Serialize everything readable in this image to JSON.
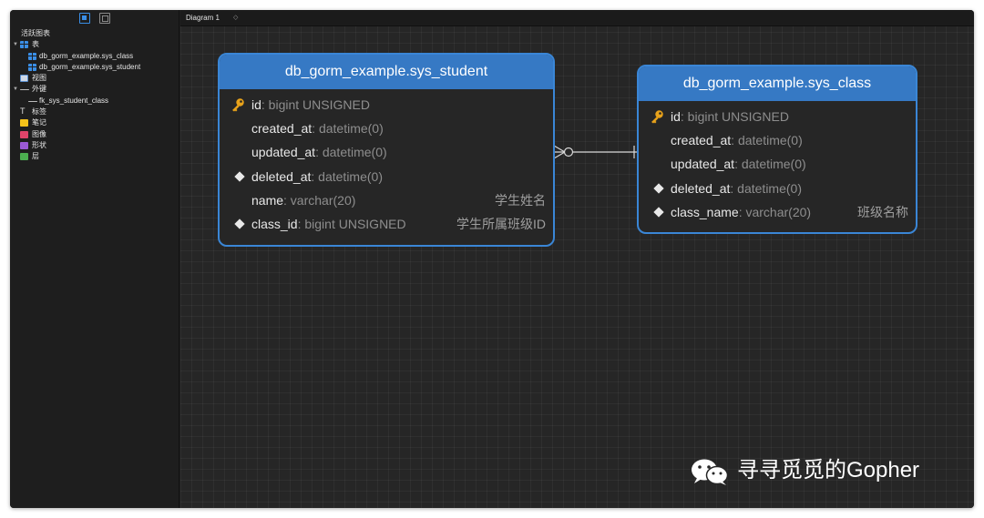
{
  "sidebar": {
    "section_title": "活跃图表",
    "tables_label": "表",
    "tables": [
      "db_gorm_example.sys_class",
      "db_gorm_example.sys_student"
    ],
    "views_label": "视图",
    "fk_label": "外键",
    "fks": [
      "fk_sys_student_class"
    ],
    "labels_label": "标签",
    "notes_label": "笔记",
    "images_label": "图像",
    "shapes_label": "形状",
    "layers_label": "层"
  },
  "tab": {
    "title": "Diagram 1",
    "caret": "◇"
  },
  "entities": {
    "student": {
      "title": "db_gorm_example.sys_student",
      "fields": [
        {
          "name": "id",
          "type": ": bigint UNSIGNED",
          "comment": "",
          "marker": "key"
        },
        {
          "name": "created_at",
          "type": ": datetime(0)",
          "comment": "",
          "marker": ""
        },
        {
          "name": "updated_at",
          "type": ": datetime(0)",
          "comment": "",
          "marker": ""
        },
        {
          "name": "deleted_at",
          "type": ": datetime(0)",
          "comment": "",
          "marker": "diamond"
        },
        {
          "name": "name",
          "type": ": varchar(20)",
          "comment": "学生姓名",
          "marker": ""
        },
        {
          "name": "class_id",
          "type": ": bigint UNSIGNED",
          "comment": "学生所属班级ID",
          "marker": "diamond"
        }
      ]
    },
    "class": {
      "title": "db_gorm_example.sys_class",
      "fields": [
        {
          "name": "id",
          "type": ": bigint UNSIGNED",
          "comment": "",
          "marker": "key"
        },
        {
          "name": "created_at",
          "type": ": datetime(0)",
          "comment": "",
          "marker": ""
        },
        {
          "name": "updated_at",
          "type": ": datetime(0)",
          "comment": "",
          "marker": ""
        },
        {
          "name": "deleted_at",
          "type": ": datetime(0)",
          "comment": "",
          "marker": "diamond"
        },
        {
          "name": "class_name",
          "type": ": varchar(20)",
          "comment": "班级名称",
          "marker": "diamond"
        }
      ]
    }
  },
  "watermark": {
    "text": "寻寻觅觅的Gopher"
  },
  "colors": {
    "header_blue": "#3679c4",
    "border_blue": "#3a86d6",
    "key_gold": "#e8a21a",
    "canvas_bg": "#262626"
  }
}
